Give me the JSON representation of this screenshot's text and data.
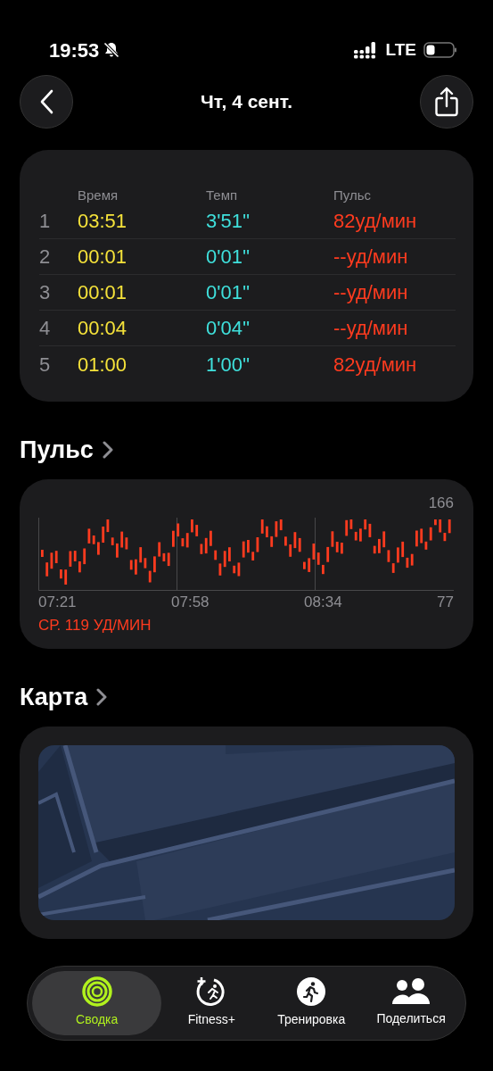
{
  "status_bar": {
    "time": "19:53",
    "network": "LTE"
  },
  "header": {
    "title": "Чт, 4 сент."
  },
  "splits": {
    "columns": [
      "Время",
      "Темп",
      "Пульс"
    ],
    "rows": [
      {
        "index": "1",
        "time": "03:51",
        "pace": "3'51''",
        "pulse": "82уд/мин"
      },
      {
        "index": "2",
        "time": "00:01",
        "pace": "0'01''",
        "pulse": "--уд/мин"
      },
      {
        "index": "3",
        "time": "00:01",
        "pace": "0'01''",
        "pulse": "--уд/мин"
      },
      {
        "index": "4",
        "time": "00:04",
        "pace": "0'04''",
        "pulse": "--уд/мин"
      },
      {
        "index": "5",
        "time": "01:00",
        "pace": "1'00''",
        "pulse": "82уд/мин"
      }
    ]
  },
  "pulse": {
    "heading": "Пульс",
    "max_label": "166",
    "min_label": "77",
    "time_labels": [
      "07:21",
      "07:58",
      "08:34"
    ],
    "average": "СР. 119 УД/МИН"
  },
  "map": {
    "heading": "Карта",
    "kind": "picture"
  },
  "tab_bar": [
    {
      "kind": "summary",
      "label": "Сводка",
      "selected": true
    },
    {
      "kind": "fitness",
      "label": "Fitness+",
      "selected": false
    },
    {
      "kind": "workout",
      "label": "Тренировка",
      "selected": false
    },
    {
      "kind": "sharing",
      "label": "Поделиться",
      "selected": false
    }
  ]
}
